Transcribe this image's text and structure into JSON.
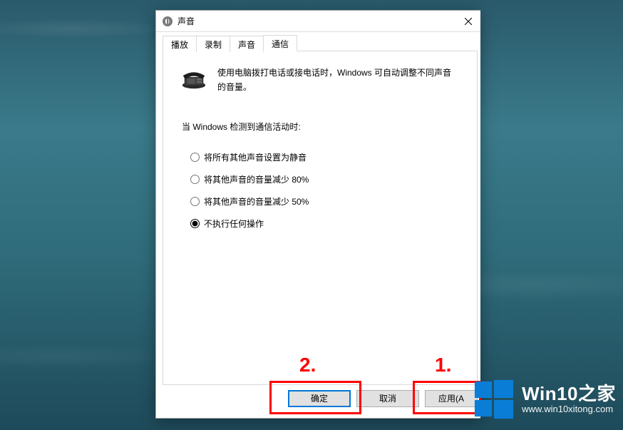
{
  "window": {
    "title": "声音"
  },
  "tabs": [
    {
      "label": "播放",
      "active": false
    },
    {
      "label": "录制",
      "active": false
    },
    {
      "label": "声音",
      "active": false
    },
    {
      "label": "通信",
      "active": true
    }
  ],
  "panel": {
    "description": "使用电脑拨打电话或接电话时，Windows 可自动调整不同声音的音量。",
    "when_label": "当 Windows 检测到通信活动时:",
    "options": [
      {
        "label": "将所有其他声音设置为静音",
        "selected": false
      },
      {
        "label": "将其他声音的音量减少 80%",
        "selected": false
      },
      {
        "label": "将其他声音的音量减少 50%",
        "selected": false
      },
      {
        "label": "不执行任何操作",
        "selected": true
      }
    ]
  },
  "buttons": {
    "ok": "确定",
    "cancel": "取消",
    "apply": "应用(A"
  },
  "annotations": {
    "num1": "1.",
    "num2": "2."
  },
  "watermark": {
    "title": "Win10之家",
    "url": "www.win10xitong.com"
  }
}
